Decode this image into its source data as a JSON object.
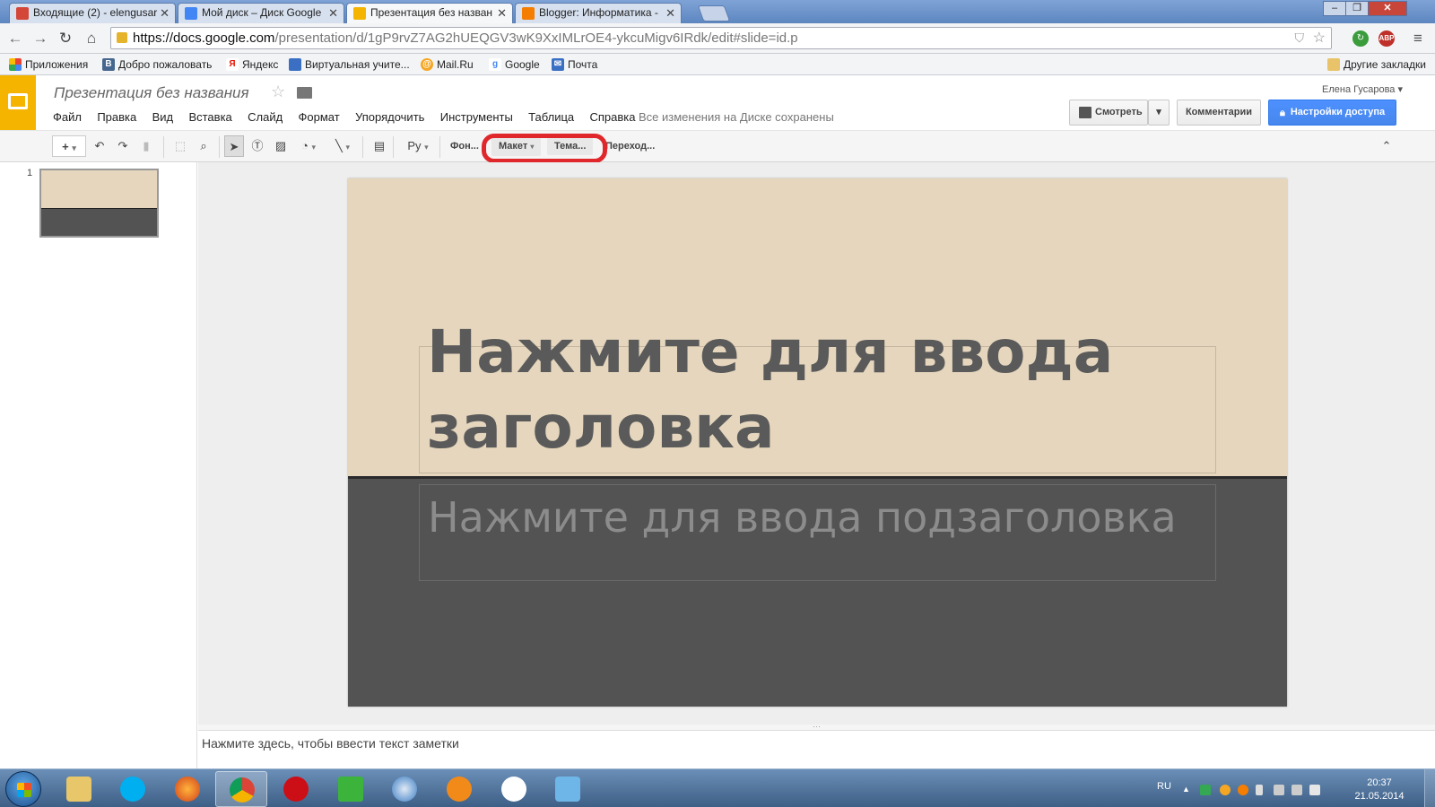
{
  "browser": {
    "tabs": [
      {
        "title": "Входящие (2) - elengusar",
        "icon_color": "#d44638"
      },
      {
        "title": "Мой диск – Диск Google",
        "icon_color": "#4285f4"
      },
      {
        "title": "Презентация без назван",
        "icon_color": "#f4b400"
      },
      {
        "title": "Blogger: Информатика -",
        "icon_color": "#f57d00"
      }
    ],
    "url_host": "https://docs.google.com",
    "url_rest": "/presentation/d/1gP9rvZ7AG2hUEQGV3wK9XxIMLrOE4-ykcuMigv6IRdk/edit#slide=id.p",
    "abp_label": "ABP",
    "bookmarks": [
      {
        "label": "Приложения",
        "icon": "apps-grid-icon"
      },
      {
        "label": "Добро пожаловать",
        "icon": "vk-icon"
      },
      {
        "label": "Яндекс",
        "icon": "yandex-icon"
      },
      {
        "label": "Виртуальная учите...",
        "icon": "doc-icon"
      },
      {
        "label": "Mail.Ru",
        "icon": "mailru-icon"
      },
      {
        "label": "Google",
        "icon": "google-icon"
      },
      {
        "label": "Почта",
        "icon": "mail-icon"
      }
    ],
    "other_bookmarks": "Другие закладки"
  },
  "docs": {
    "title": "Презентация без названия",
    "user": "Елена Гусарова",
    "menu": [
      "Файл",
      "Правка",
      "Вид",
      "Вставка",
      "Слайд",
      "Формат",
      "Упорядочить",
      "Инструменты",
      "Таблица",
      "Справка"
    ],
    "save_status": "Все изменения на Диске сохранены",
    "present_label": "Смотреть",
    "comments_label": "Комментарии",
    "share_label": "Настройки доступа"
  },
  "toolbar": {
    "lang_label": "Ру",
    "background_label": "Фон...",
    "layout_label": "Макет",
    "theme_label": "Тема...",
    "transition_label": "Переход..."
  },
  "filmstrip": {
    "slide_number": "1"
  },
  "slide": {
    "title_placeholder": "Нажмите для ввода заголовка",
    "subtitle_placeholder": "Нажмите для ввода подзаголовка"
  },
  "notes": {
    "placeholder": "Нажмите здесь, чтобы ввести текст заметки"
  },
  "taskbar": {
    "lang": "RU",
    "time": "20:37",
    "date": "21.05.2014"
  },
  "colors": {
    "slide_top": "#e5d6bd",
    "slide_bottom": "#535353",
    "accent_blue": "#4d90fe",
    "highlight_red": "#e0282c",
    "slides_yellow": "#f4b400"
  }
}
